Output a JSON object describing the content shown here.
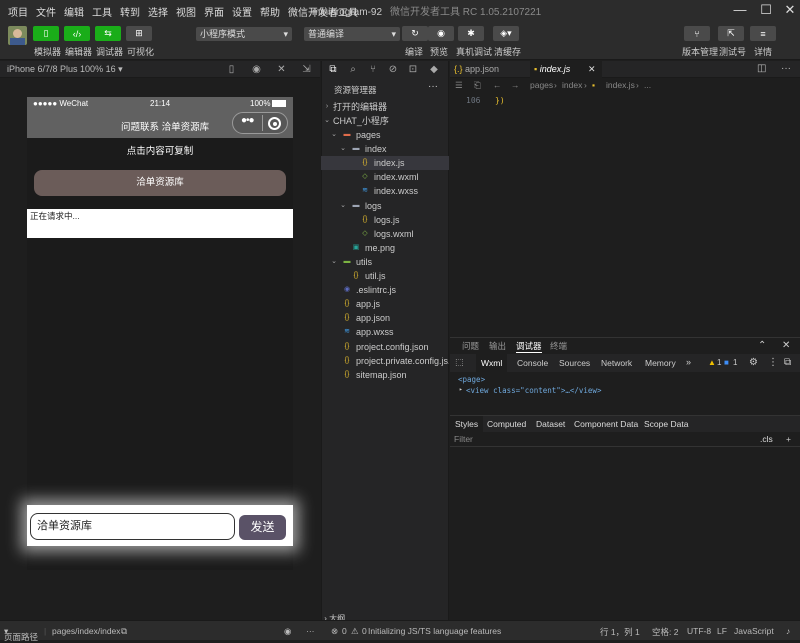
{
  "menu": [
    "项目",
    "文件",
    "编辑",
    "工具",
    "转到",
    "选择",
    "视图",
    "界面",
    "设置",
    "帮助",
    "微信开发者工具"
  ],
  "window": {
    "title": "miniprogram-92",
    "subtitle": "微信开发者工具 RC 1.05.2107221"
  },
  "toolbar": {
    "simulator_label": "模拟器",
    "editor_label": "编辑器",
    "debugger_label": "调试器",
    "visual_label": "可视化",
    "mode_select": "小程序模式",
    "compile_select": "普通编译",
    "compile_label": "编译",
    "preview_label": "预览",
    "realdebug_label": "真机调试",
    "clearcache_label": "清缓存",
    "version_label": "版本管理",
    "testid_label": "测试号",
    "details_label": "详情"
  },
  "simulator": {
    "device": "iPhone 6/7/8 Plus 100% 16",
    "status_carrier": "●●●●● WeChat",
    "status_time": "21:14",
    "status_battery": "100%",
    "nav_title": "问题联系 洽单资源库",
    "copy_tip": "点击内容可复制",
    "main_button": "洽单资源库",
    "request_text": "正在请求中...",
    "input_value": "洽单资源库",
    "send_button": "发送"
  },
  "explorer": {
    "title": "资源管理器",
    "open_editors": "打开的编辑器",
    "project": "CHAT_小程序",
    "outline": "大纲",
    "tree": [
      {
        "name": "pages",
        "depth": 1,
        "kind": "folder-open",
        "color": "#e06c4b"
      },
      {
        "name": "index",
        "depth": 2,
        "kind": "folder-open",
        "color": "#9da5b4"
      },
      {
        "name": "index.js",
        "depth": 3,
        "kind": "js",
        "color": "#e8bf2e",
        "active": true
      },
      {
        "name": "index.wxml",
        "depth": 3,
        "kind": "wxml",
        "color": "#8bc34a"
      },
      {
        "name": "index.wxss",
        "depth": 3,
        "kind": "wxss",
        "color": "#42a5f5"
      },
      {
        "name": "logs",
        "depth": 2,
        "kind": "folder-open",
        "color": "#9da5b4"
      },
      {
        "name": "logs.js",
        "depth": 3,
        "kind": "js",
        "color": "#e8bf2e"
      },
      {
        "name": "logs.wxml",
        "depth": 3,
        "kind": "wxml",
        "color": "#8bc34a"
      },
      {
        "name": "me.png",
        "depth": 2,
        "kind": "png",
        "color": "#26a69a"
      },
      {
        "name": "utils",
        "depth": 1,
        "kind": "folder-open",
        "color": "#7cb342"
      },
      {
        "name": "util.js",
        "depth": 2,
        "kind": "js",
        "color": "#e8bf2e"
      },
      {
        "name": ".eslintrc.js",
        "depth": 1,
        "kind": "eslint",
        "color": "#5c6bc0"
      },
      {
        "name": "app.js",
        "depth": 1,
        "kind": "js",
        "color": "#e8bf2e"
      },
      {
        "name": "app.json",
        "depth": 1,
        "kind": "json",
        "color": "#e8bf2e"
      },
      {
        "name": "app.wxss",
        "depth": 1,
        "kind": "wxss",
        "color": "#42a5f5"
      },
      {
        "name": "project.config.json",
        "depth": 1,
        "kind": "json",
        "color": "#e8bf2e"
      },
      {
        "name": "project.private.config.js...",
        "depth": 1,
        "kind": "json",
        "color": "#e8bf2e"
      },
      {
        "name": "sitemap.json",
        "depth": 1,
        "kind": "json",
        "color": "#e8bf2e"
      }
    ]
  },
  "editor": {
    "tabs": [
      {
        "name": "app.json"
      },
      {
        "name": "index.js"
      }
    ],
    "breadcrumb": [
      "pages",
      "index",
      "index.js",
      "..."
    ],
    "line_number": "106",
    "code": "})"
  },
  "panel": {
    "tabs": [
      "问题",
      "输出",
      "调试器",
      "终端"
    ],
    "devtools_tabs": [
      "Wxml",
      "Console",
      "Sources",
      "Network",
      "Memory"
    ],
    "warn_count": "1",
    "info_count": "1",
    "dom_page": "<page>",
    "dom_view": "<view class=\"content\">…</view>",
    "styles_tabs": [
      "Styles",
      "Computed",
      "Dataset",
      "Component Data",
      "Scope Data"
    ],
    "filter_placeholder": "Filter",
    "cls": ".cls"
  },
  "statusbar": {
    "path_label": "页面路径",
    "path": "pages/index/index",
    "errors": "0",
    "warnings": "0",
    "message": "Initializing JS/TS language features",
    "position": "行 1，列 1",
    "spaces": "空格: 2",
    "encoding": "UTF-8",
    "eol": "LF",
    "language": "JavaScript"
  }
}
